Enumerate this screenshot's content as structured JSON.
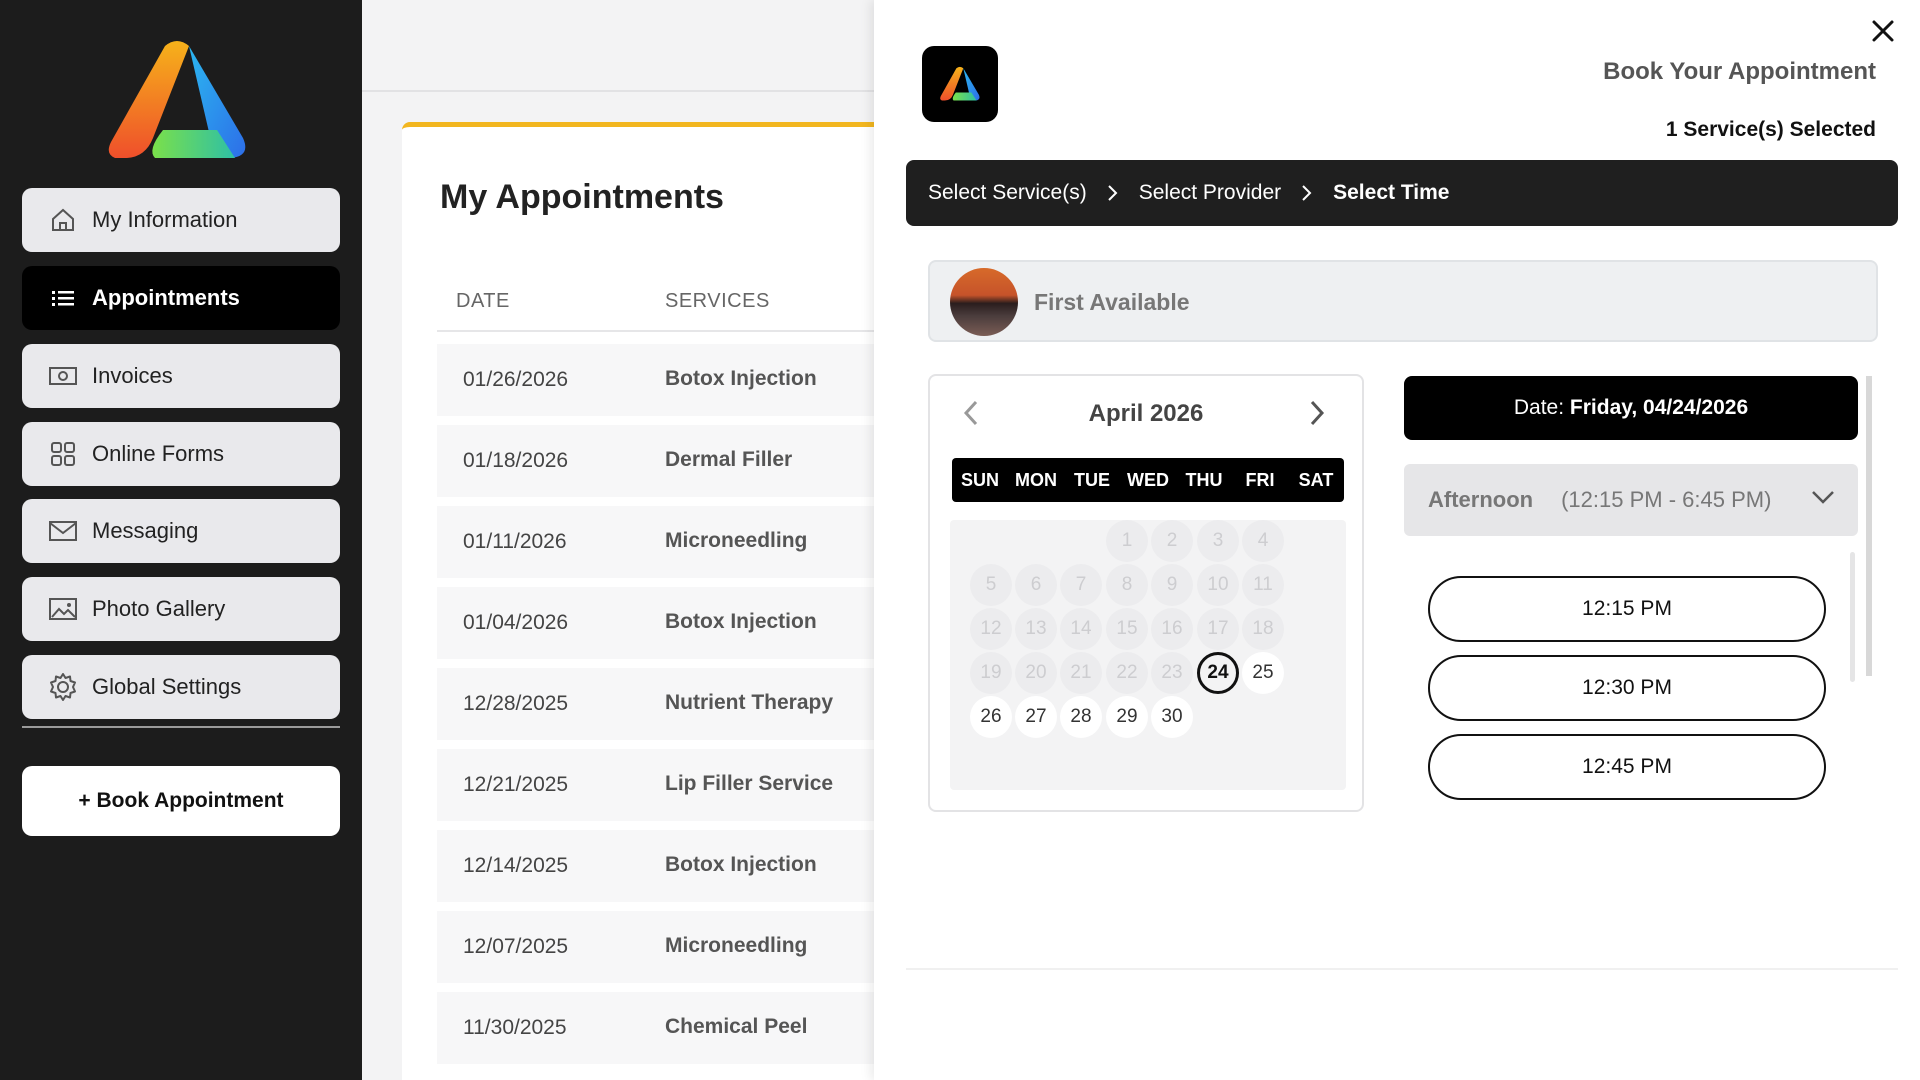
{
  "sidebar": {
    "items": [
      {
        "label": "My Information",
        "icon": "home-icon"
      },
      {
        "label": "Appointments",
        "icon": "list-icon",
        "active": true
      },
      {
        "label": "Invoices",
        "icon": "money-icon"
      },
      {
        "label": "Online Forms",
        "icon": "grid-icon"
      },
      {
        "label": "Messaging",
        "icon": "mail-icon"
      },
      {
        "label": "Photo Gallery",
        "icon": "image-icon"
      },
      {
        "label": "Global Settings",
        "icon": "gear-icon"
      }
    ],
    "book_label": "+ Book Appointment"
  },
  "main": {
    "title": "My Appointments",
    "columns": [
      "DATE",
      "SERVICES"
    ],
    "rows": [
      {
        "date": "01/26/2026",
        "service": "Botox Injection"
      },
      {
        "date": "01/18/2026",
        "service": "Dermal Filler"
      },
      {
        "date": "01/11/2026",
        "service": "Microneedling"
      },
      {
        "date": "01/04/2026",
        "service": "Botox Injection"
      },
      {
        "date": "12/28/2025",
        "service": "Nutrient Therapy"
      },
      {
        "date": "12/21/2025",
        "service": "Lip Filler Service"
      },
      {
        "date": "12/14/2025",
        "service": "Botox Injection"
      },
      {
        "date": "12/07/2025",
        "service": "Microneedling"
      },
      {
        "date": "11/30/2025",
        "service": "Chemical Peel"
      }
    ]
  },
  "panel": {
    "title": "Book Your Appointment",
    "subtitle": "1 Service(s) Selected",
    "steps": [
      "Select Service(s)",
      "Select Provider",
      "Select Time"
    ],
    "provider": "First Available",
    "calendar": {
      "month": "April 2026",
      "days_of_week": [
        "SUN",
        "MON",
        "TUE",
        "WED",
        "THU",
        "FRI",
        "SAT"
      ],
      "selected_day": "24",
      "day_numbers": [
        "1",
        "2",
        "3",
        "4",
        "5",
        "6",
        "7",
        "8",
        "9",
        "10",
        "11",
        "12",
        "13",
        "14",
        "15",
        "16",
        "17",
        "18",
        "19",
        "20",
        "21",
        "22",
        "23",
        "24",
        "25",
        "26",
        "27",
        "28",
        "29",
        "30"
      ]
    },
    "date_label": "Date:",
    "date_value": "Friday, 04/24/2026",
    "period_label": "Afternoon",
    "period_range": "(12:15 PM - 6:45 PM)",
    "slots": [
      "12:15 PM",
      "12:30 PM",
      "12:45 PM"
    ]
  },
  "colors": {
    "accent": "#f2b61f",
    "dark": "#1c1c1c"
  }
}
